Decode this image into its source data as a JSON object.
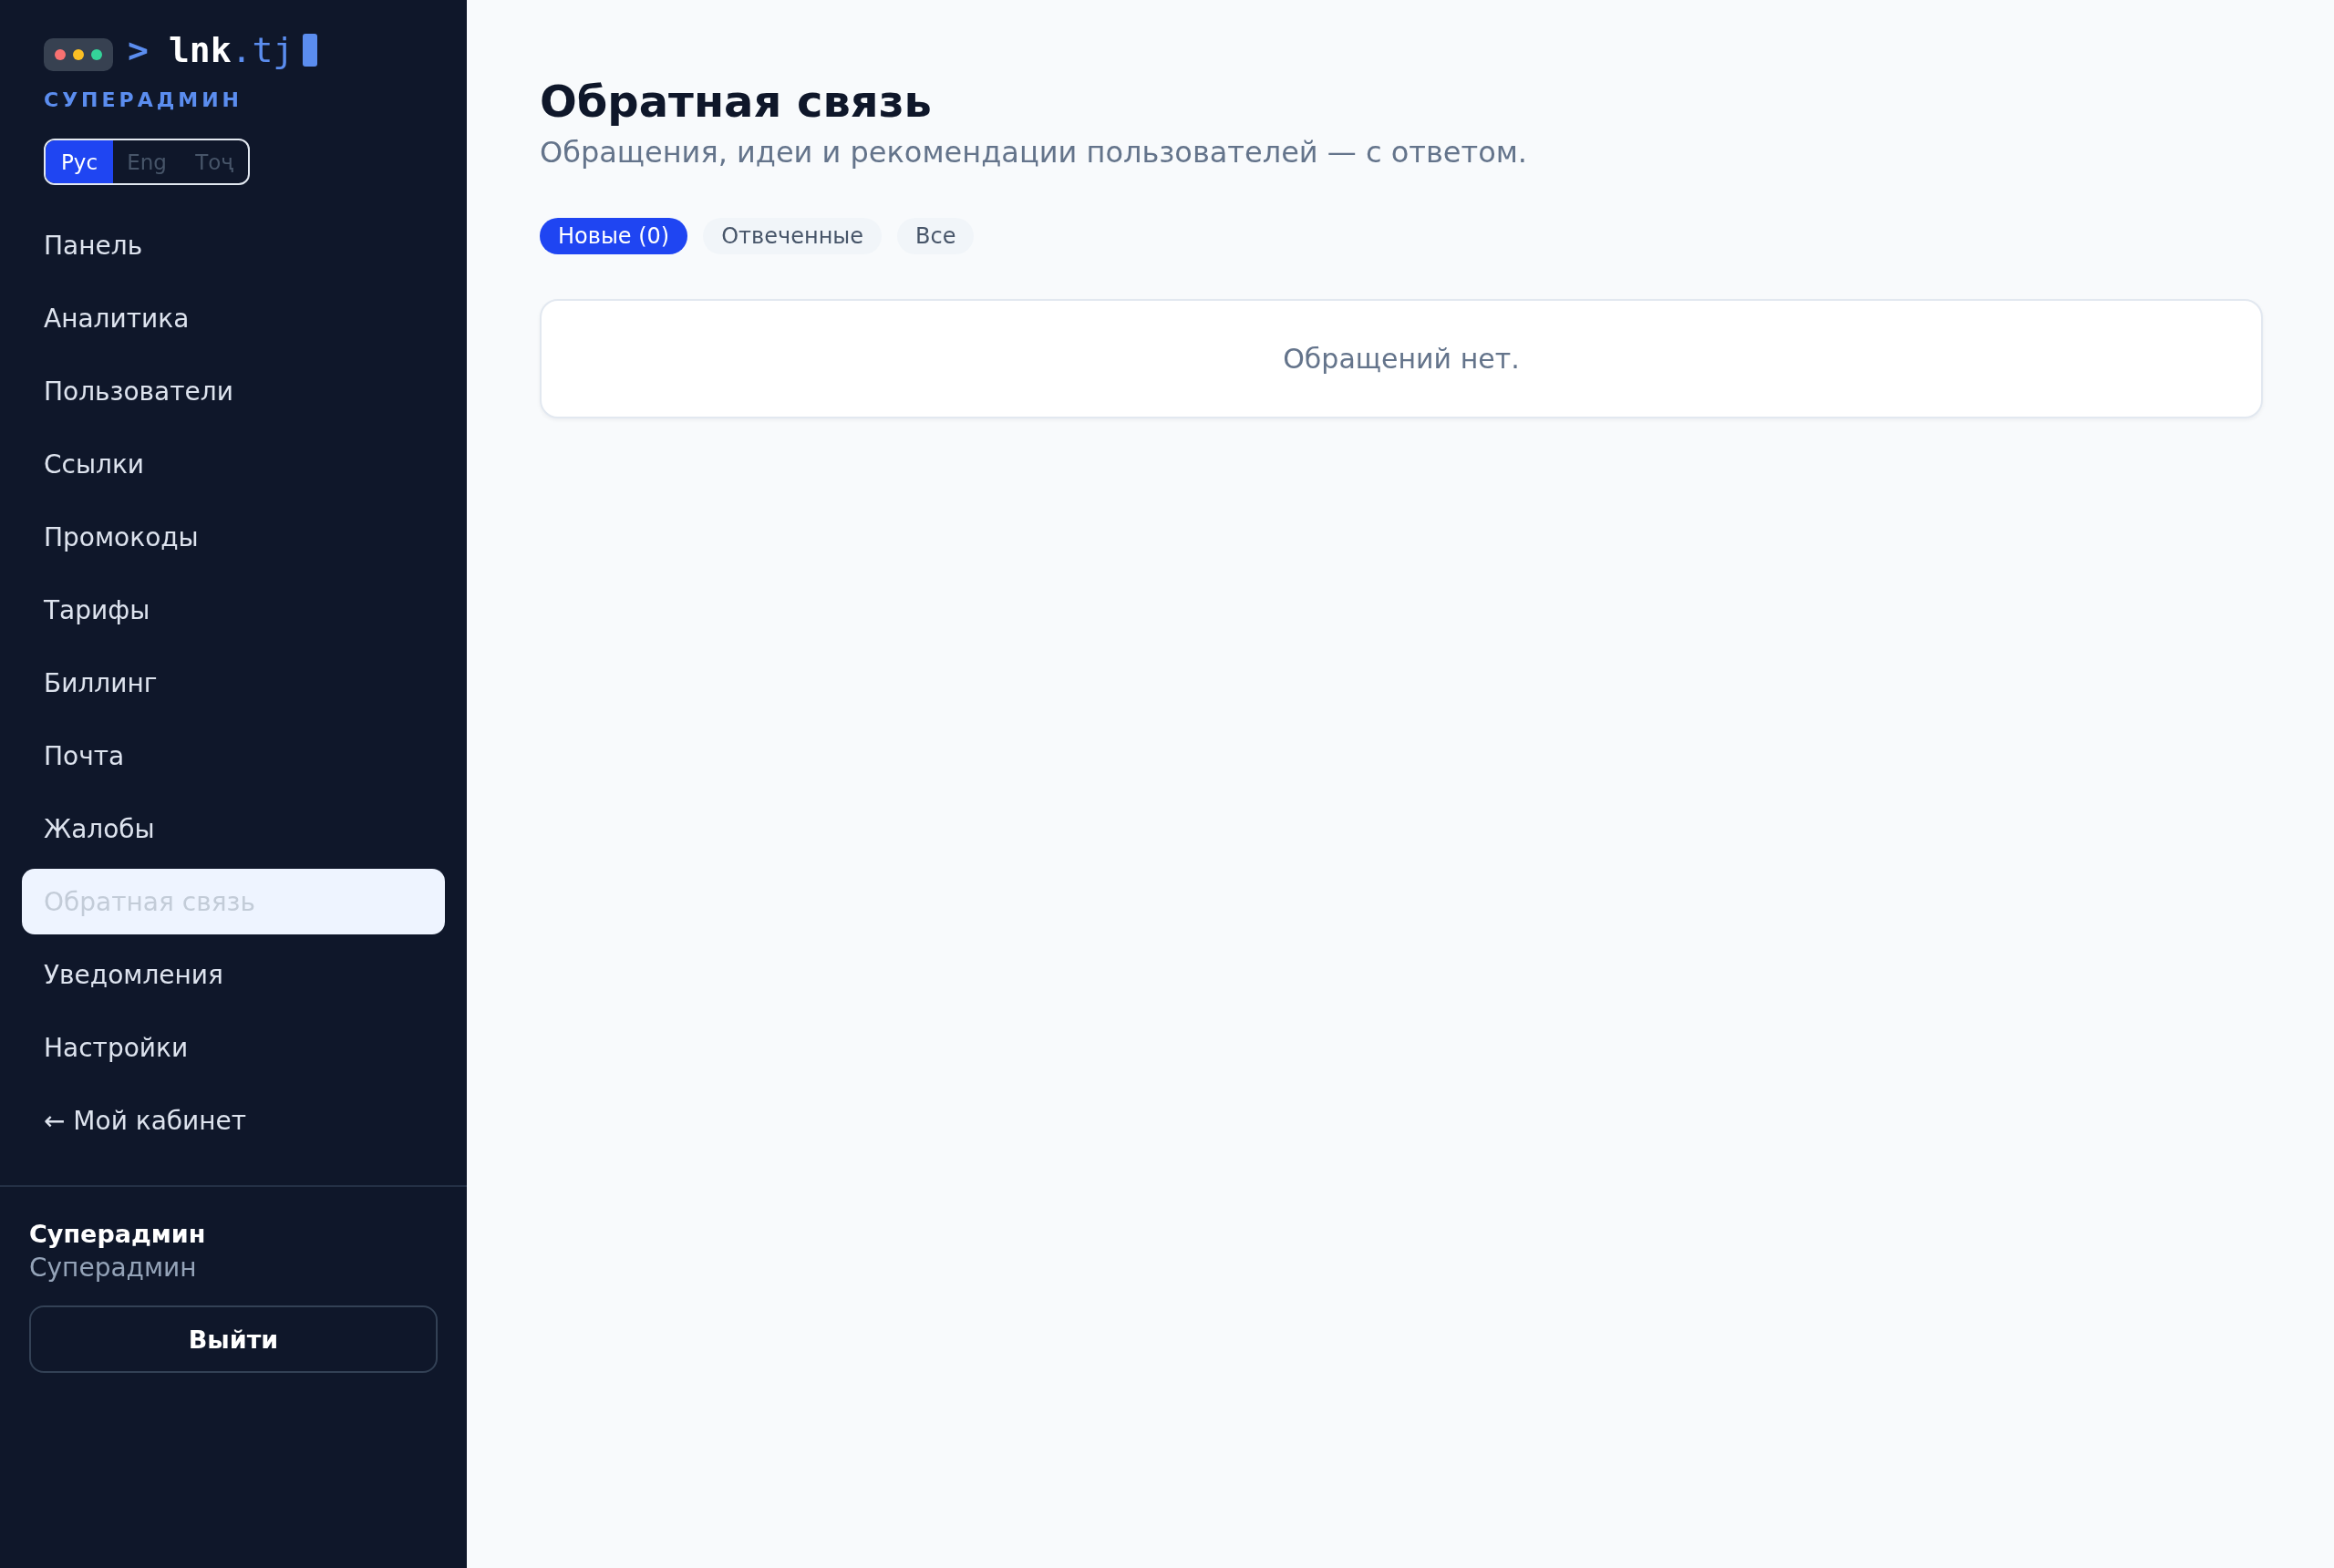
{
  "sidebar": {
    "logo": {
      "prompt": ">",
      "text": "**lnk**.tj"
    },
    "role_label": "СУПЕРАДМИН",
    "languages": [
      {
        "label": "Рус",
        "selected": true
      },
      {
        "label": "Eng",
        "selected": false
      },
      {
        "label": "Тоҷ",
        "selected": false
      }
    ],
    "nav_items": [
      {
        "label": "Панель",
        "selected": false
      },
      {
        "label": "Аналитика",
        "selected": false
      },
      {
        "label": "Пользователи",
        "selected": false
      },
      {
        "label": "Ссылки",
        "selected": false
      },
      {
        "label": "Промокоды",
        "selected": false
      },
      {
        "label": "Тарифы",
        "selected": false
      },
      {
        "label": "Биллинг",
        "selected": false
      },
      {
        "label": "Почта",
        "selected": false
      },
      {
        "label": "Жалобы",
        "selected": false
      },
      {
        "label": "Обратная связь",
        "selected": true
      },
      {
        "label": "Уведомления",
        "selected": false
      },
      {
        "label": "Настройки",
        "selected": false
      },
      {
        "label": "← Мой кабинет",
        "selected": false
      }
    ],
    "user": {
      "name": "Суперадмин",
      "role": "Суперадмин"
    },
    "logout_button": "Выйти"
  },
  "main": {
    "title": "Обратная связь",
    "subtitle": "Обращения, идеи и рекомендации пользователей — с ответом.",
    "tabs": [
      {
        "label": "Новые (0)",
        "selected": true
      },
      {
        "label": "Отвеченные",
        "selected": false
      },
      {
        "label": "Все",
        "selected": false
      }
    ],
    "empty_message": "Обращений нет."
  }
}
